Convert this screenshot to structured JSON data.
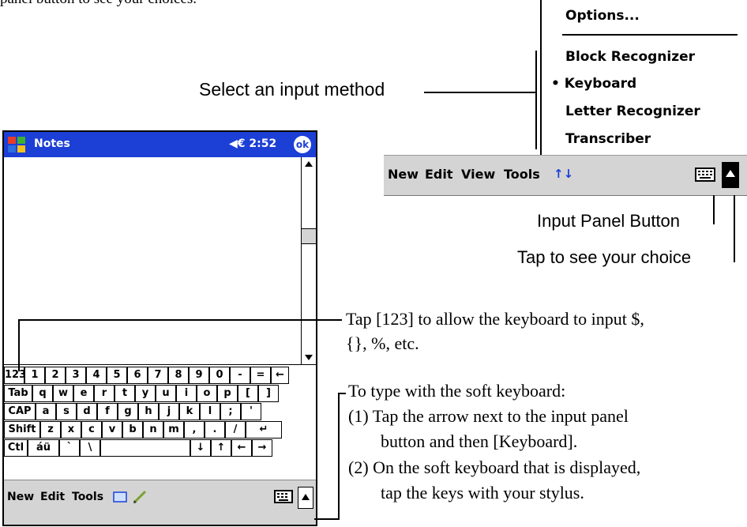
{
  "intro_text": "panel button to see your choices.",
  "menu": {
    "items": [
      "Options...",
      "Block Recognizer",
      "Keyboard",
      "Letter Recognizer",
      "Transcriber"
    ],
    "selected_bullet": "•"
  },
  "right_toolbar": {
    "new": "New",
    "edit": "Edit",
    "view": "View",
    "tools": "Tools",
    "up_down_arrows": "↑↓"
  },
  "labels": {
    "select_input_method": "Select an input method",
    "input_panel_button": "Input Panel Button",
    "tap_to_see": "Tap to see your choice",
    "tap_123_line1": "Tap [123] to allow the keyboard to input $,",
    "tap_123_line2": "{}, %, etc.",
    "soft_kb_title": "To type with the soft keyboard:",
    "soft_kb_1a": "(1) Tap the arrow next to the input panel",
    "soft_kb_1b": "button and then [Keyboard].",
    "soft_kb_2a": "(2) On the soft keyboard that is displayed,",
    "soft_kb_2b": "tap the keys with your stylus."
  },
  "device": {
    "title": "Notes",
    "time": "◀€ 2:52",
    "ok": "ok",
    "keyboard_rows": [
      [
        "123",
        "1",
        "2",
        "3",
        "4",
        "5",
        "6",
        "7",
        "8",
        "9",
        "0",
        "-",
        "=",
        "←"
      ],
      [
        "Tab",
        "q",
        "w",
        "e",
        "r",
        "t",
        "y",
        "u",
        "i",
        "o",
        "p",
        "[",
        "]"
      ],
      [
        "CAP",
        "a",
        "s",
        "d",
        "f",
        "g",
        "h",
        "j",
        "k",
        "l",
        ";",
        "'"
      ],
      [
        "Shift",
        "z",
        "x",
        "c",
        "v",
        "b",
        "n",
        "m",
        ",",
        ".",
        "/",
        "↵"
      ],
      [
        "Ctl",
        "áü",
        "`",
        "\\",
        "",
        "↓",
        "↑",
        "←",
        "→"
      ]
    ],
    "bottom_menu": {
      "new": "New",
      "edit": "Edit",
      "tools": "Tools"
    }
  },
  "colors": {
    "titlebar": "#1c3fd6",
    "toolbar_gray": "#d4d4d4"
  }
}
